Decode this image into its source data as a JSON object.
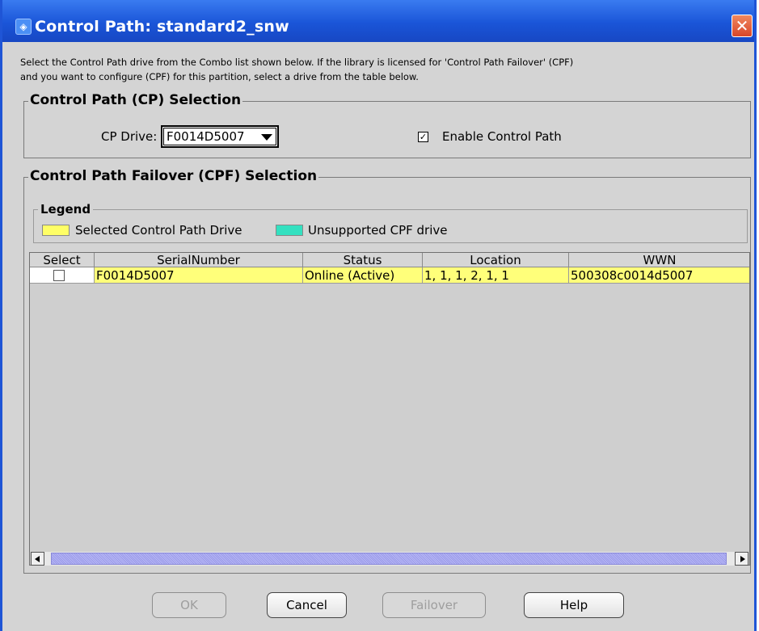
{
  "window": {
    "title": "Control Path: standard2_snw",
    "close_glyph": "✕"
  },
  "description": {
    "line1": "Select the Control Path drive from the Combo list shown below. If the library is licensed for 'Control Path Failover' (CPF)",
    "line2": "and you want to configure (CPF) for this partition, select a drive from the table below."
  },
  "cp_section": {
    "title": "Control Path (CP) Selection",
    "drive_label": "CP Drive:",
    "drive_value": "F0014D5007",
    "enable_label": "Enable Control Path",
    "enable_checked": true,
    "check_glyph": "✓"
  },
  "cpf_section": {
    "title": "Control Path Failover (CPF) Selection",
    "legend": {
      "title": "Legend",
      "items": [
        {
          "label": "Selected Control Path Drive",
          "color": "#ffff66"
        },
        {
          "label": "Unsupported CPF drive",
          "color": "#33e0c0"
        }
      ]
    },
    "table": {
      "columns": [
        "Select",
        "SerialNumber",
        "Status",
        "Location",
        "WWN"
      ],
      "rows": [
        {
          "select": false,
          "serial": "F0014D5007",
          "status": "Online (Active)",
          "location": "1, 1, 1, 2, 1, 1",
          "wwn": "500308c0014d5007",
          "highlight": "#ffff7a"
        }
      ]
    }
  },
  "buttons": {
    "ok": "OK",
    "cancel": "Cancel",
    "failover": "Failover",
    "help": "Help"
  },
  "colors": {
    "title_bar": "#1a55d8",
    "selected_drive": "#ffff66",
    "unsupported_cpf": "#33e0c0"
  }
}
